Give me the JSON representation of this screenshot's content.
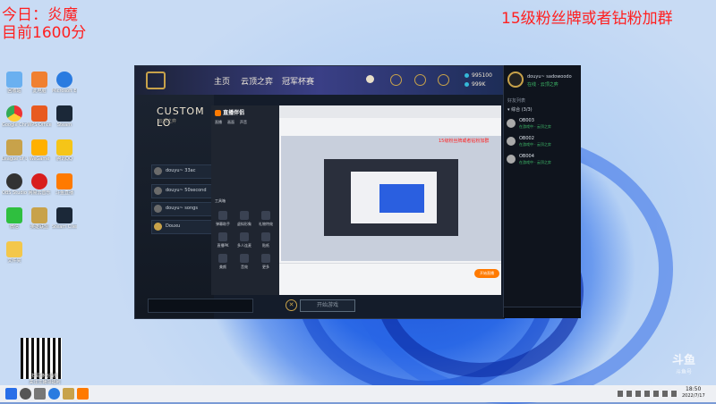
{
  "stream_overlay": {
    "line1": "今日：炎魔",
    "line2": "目前1600分",
    "group_notice": "15级粉丝牌或者钻粉加群"
  },
  "lol_client": {
    "nav": [
      "主页",
      "云顶之弈",
      "冠军杯赛"
    ],
    "currency_rp": "995100",
    "currency_be": "999K",
    "lobby_title": "CUSTOM LO",
    "lobby_sub": "云顶之弈",
    "players": [
      "douyu~ 33ac",
      "douyu~ 50second",
      "douyu~ songs",
      "Douxu"
    ],
    "start_button": "开始游戏"
  },
  "friends": {
    "self_name": "douyu~ sadowoodo",
    "self_status": "在线 · 云顶之弈",
    "section_title": "好友列表",
    "group_label": "▾ 综合 (3/3)",
    "items": [
      {
        "name": "OB003",
        "status": "在游戏中 · 云顶之弈"
      },
      {
        "name": "OB002",
        "status": "在游戏中 · 云顶之弈"
      },
      {
        "name": "OB004",
        "status": "在游戏中 · 云顶之弈"
      }
    ]
  },
  "obs": {
    "brand": "直播伴侣",
    "tabs": [
      "直播",
      "画面",
      "声音"
    ],
    "tools_header": "工具箱",
    "tools": [
      "弹幕助手",
      "虚拟形象",
      "礼物特效",
      "直播PK",
      "多人连麦",
      "贴纸",
      "美颜",
      "音效",
      "更多"
    ],
    "start_live": "开始直播",
    "notice": "15级粉丝牌或者钻粉加群"
  },
  "desktop": {
    "icons": [
      "回收站",
      "此电脑",
      "Microsoft Edge",
      "Google Chrome",
      "WPS Office",
      "Steam",
      "League of Legends",
      "WeGame",
      "腾讯QQ",
      "OBS Studio",
      "网易云音乐",
      "斗鱼直播",
      "微信",
      "英雄联盟",
      "Steam Client",
      "文件夹"
    ]
  },
  "qr_caption": "扫码参与抽奖\n关注主播领福利",
  "watermark": {
    "brand": "斗鱼",
    "sub": "斗鱼号"
  },
  "taskbar": {
    "time": "18:50",
    "date": "2022/7/17"
  }
}
